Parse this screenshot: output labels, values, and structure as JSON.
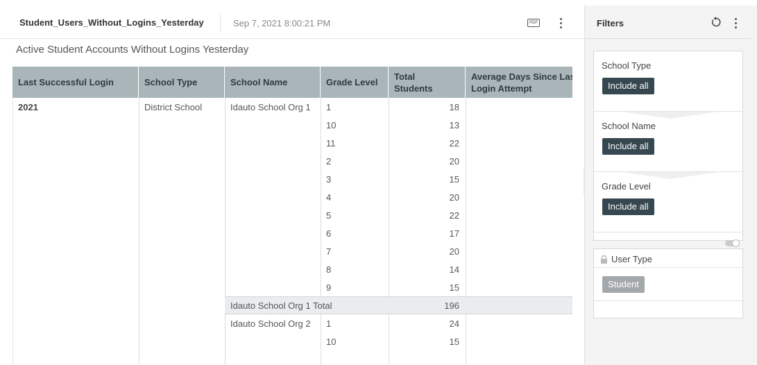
{
  "header": {
    "title": "Student_Users_Without_Logins_Yesterday",
    "timestamp": "Sep 7, 2021 8:00:21 PM",
    "pdf_label": "PDF",
    "pdf_icon": "pdf-icon",
    "menu_icon": "kebab-menu-icon"
  },
  "subtitle": "Active Student Accounts Without Logins Yesterday",
  "table": {
    "header_color": "#a9b5b9",
    "columns": [
      "Last Successful Login",
      "School Type",
      "School Name",
      "Grade Level",
      "Total Students",
      "Average Days Since Last Login Attempt"
    ],
    "column_display": [
      "Last Successful Login",
      "School Type",
      "School Name",
      "Grade Level",
      "Total\nStudents",
      "Average Days Since Las\nLogin Attempt"
    ],
    "group": {
      "last_successful_login": "2021",
      "school_type": "District School",
      "schools": [
        {
          "name": "Idauto School Org 1",
          "rows": [
            {
              "grade": "1",
              "total": "18"
            },
            {
              "grade": "10",
              "total": "13"
            },
            {
              "grade": "11",
              "total": "22"
            },
            {
              "grade": "2",
              "total": "20"
            },
            {
              "grade": "3",
              "total": "15"
            },
            {
              "grade": "4",
              "total": "20"
            },
            {
              "grade": "5",
              "total": "22"
            },
            {
              "grade": "6",
              "total": "17"
            },
            {
              "grade": "7",
              "total": "20"
            },
            {
              "grade": "8",
              "total": "14"
            },
            {
              "grade": "9",
              "total": "15"
            }
          ],
          "total_label": "Idauto School Org 1 Total",
          "total_value": "196"
        },
        {
          "name": "Idauto School Org 2",
          "rows": [
            {
              "grade": "1",
              "total": "24"
            },
            {
              "grade": "10",
              "total": "15"
            }
          ]
        }
      ]
    }
  },
  "filters": {
    "title": "Filters",
    "reset_icon": "reset-icon",
    "menu_icon": "kebab-menu-icon",
    "chip_color": "#36474f",
    "sections": [
      {
        "label": "School Type",
        "chip": "Include all"
      },
      {
        "label": "School Name",
        "chip": "Include all"
      },
      {
        "label": "Grade Level",
        "chip": "Include all"
      }
    ],
    "locked": {
      "label": "User Type",
      "chip": "Student",
      "icon": "lock-icon"
    }
  }
}
